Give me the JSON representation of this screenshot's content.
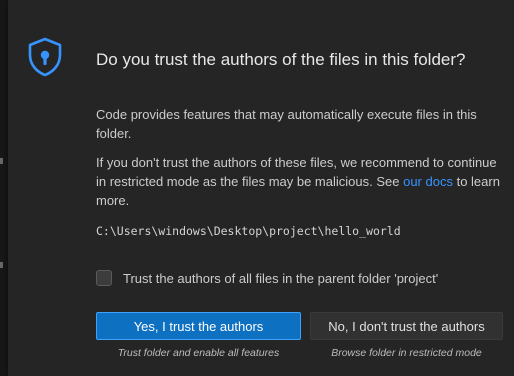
{
  "dialog": {
    "title": "Do you trust the authors of the files in this folder?",
    "icon": "shield-lock-icon",
    "paragraph1": "Code provides features that may automatically execute files in this folder.",
    "paragraph2_before": "If you don't trust the authors of these files, we recommend to continue in restricted mode as the files may be malicious. See ",
    "paragraph2_link": "our docs",
    "paragraph2_after": " to learn more.",
    "folder_path": "C:\\Users\\windows\\Desktop\\project\\hello_world",
    "checkbox_label": "Trust the authors of all files in the parent folder 'project'",
    "checkbox_checked": false,
    "buttons": {
      "trust_label": "Yes, I trust the authors",
      "trust_caption": "Trust folder and enable all features",
      "dont_trust_label": "No, I don't trust the authors",
      "dont_trust_caption": "Browse folder in restricted mode"
    }
  },
  "colors": {
    "accent": "#3794ff",
    "primary_button": "#0e70c0",
    "dialog_bg": "#252526"
  }
}
